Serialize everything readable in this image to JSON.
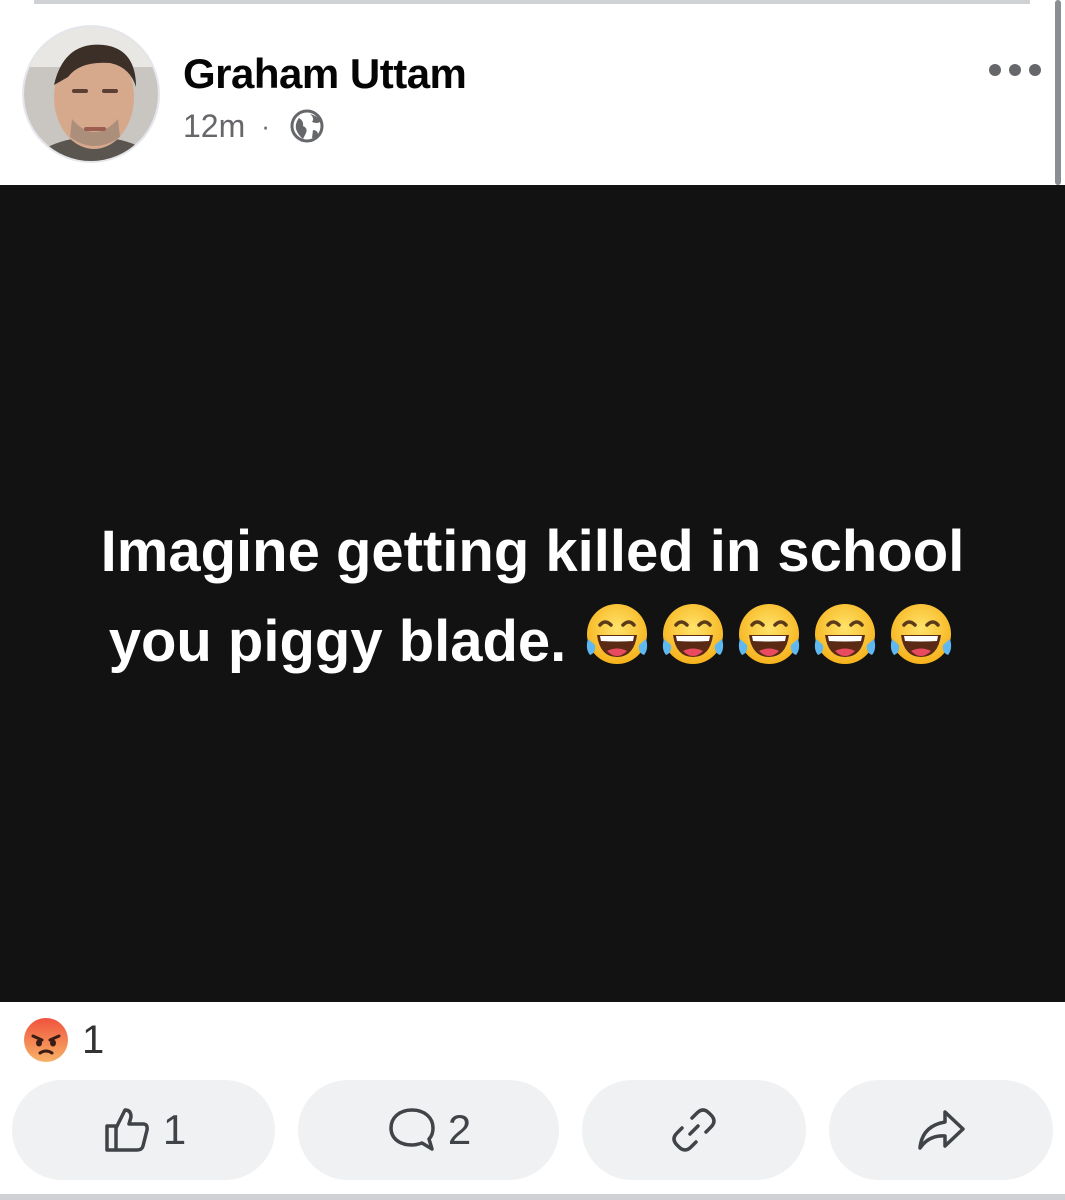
{
  "post": {
    "author": "Graham Uttam",
    "time": "12m",
    "separator": "·",
    "privacy_icon": "globe-icon",
    "more_icon": "more-horizontal-icon",
    "text_line1": "Imagine getting killed in school",
    "text_line2": "you piggy blade.",
    "emoji_icon": "face-with-tears-of-joy-icon",
    "emoji_count": 5,
    "background_color": "#121212",
    "text_color": "#ffffff"
  },
  "reactions": {
    "icon": "angry-face-icon",
    "count": "1"
  },
  "actions": {
    "like": {
      "icon": "thumbs-up-icon",
      "count": "1"
    },
    "comment": {
      "icon": "speech-bubble-icon",
      "count": "2"
    },
    "copy_link": {
      "icon": "link-icon"
    },
    "share": {
      "icon": "share-arrow-icon"
    }
  },
  "colors": {
    "secondary_text": "#65676b",
    "button_bg": "#f0f1f3",
    "divider": "#cfd1d4"
  }
}
